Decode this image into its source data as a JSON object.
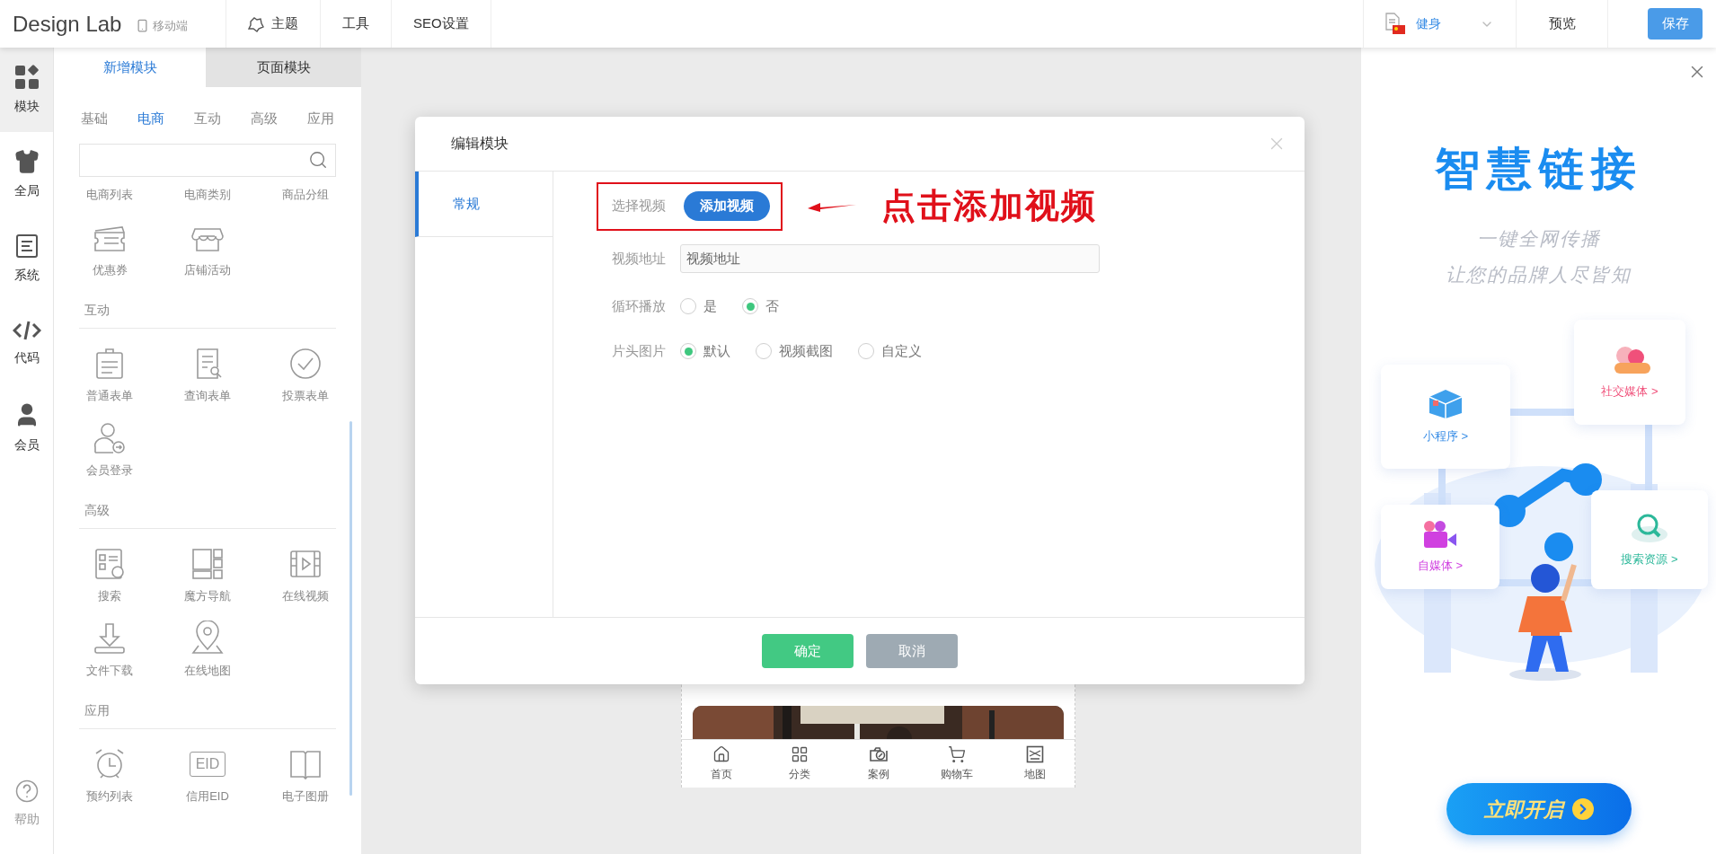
{
  "top_bar": {
    "logo": "Design Lab",
    "device": "移动端",
    "menu": [
      {
        "label": "主题",
        "kind": "icon"
      },
      {
        "label": "工具",
        "kind": "text"
      },
      {
        "label": "SEO设置",
        "kind": "text"
      }
    ],
    "language": "健身",
    "preview": "预览",
    "save": "保存"
  },
  "left_rail": {
    "items": [
      {
        "label": "模块",
        "selected": true
      },
      {
        "label": "全局",
        "selected": false
      },
      {
        "label": "系统",
        "selected": false
      },
      {
        "label": "代码",
        "selected": false
      },
      {
        "label": "会员",
        "selected": false
      }
    ],
    "help": "帮助"
  },
  "module_panel": {
    "tabs": [
      {
        "label": "新增模块",
        "selected": true
      },
      {
        "label": "页面模块",
        "selected": false
      }
    ],
    "categories": [
      {
        "label": "基础",
        "selected": false
      },
      {
        "label": "电商",
        "selected": true
      },
      {
        "label": "互动",
        "selected": false
      },
      {
        "label": "高级",
        "selected": false
      },
      {
        "label": "应用",
        "selected": false
      }
    ],
    "top_row_labels": [
      "电商列表",
      "电商类别",
      "商品分组"
    ],
    "sections": [
      {
        "items": [
          {
            "label": "优惠券"
          },
          {
            "label": "店铺活动"
          }
        ]
      },
      {
        "title": "互动",
        "items": [
          {
            "label": "普通表单"
          },
          {
            "label": "查询表单"
          },
          {
            "label": "投票表单"
          },
          {
            "label": "会员登录"
          }
        ]
      },
      {
        "title": "高级",
        "items": [
          {
            "label": "搜索"
          },
          {
            "label": "魔方导航"
          },
          {
            "label": "在线视频"
          },
          {
            "label": "文件下载"
          },
          {
            "label": "在线地图"
          }
        ]
      },
      {
        "title": "应用",
        "items": [
          {
            "label": "预约列表"
          },
          {
            "label": "信用EID",
            "icon_text": "EID"
          },
          {
            "label": "电子图册"
          }
        ]
      }
    ]
  },
  "dialog": {
    "title": "编辑模块",
    "tabs": [
      {
        "label": "常规",
        "selected": true
      }
    ],
    "fields": [
      {
        "kind": "button",
        "label": "选择视频",
        "button": "添加视频",
        "highlighted": true
      },
      {
        "kind": "input",
        "label": "视频地址",
        "value": "视频地址"
      },
      {
        "kind": "radio",
        "label": "循环播放",
        "options": [
          {
            "label": "是",
            "selected": false
          },
          {
            "label": "否",
            "selected": true
          }
        ]
      },
      {
        "kind": "radio",
        "label": "片头图片",
        "options": [
          {
            "label": "默认",
            "selected": true
          },
          {
            "label": "视频截图",
            "selected": false
          },
          {
            "label": "自定义",
            "selected": false
          }
        ]
      }
    ],
    "annotation": "点击添加视频",
    "buttons": [
      {
        "label": "确定",
        "kind": "primary"
      },
      {
        "label": "取消",
        "kind": "secondary"
      }
    ]
  },
  "phone": {
    "tabs": [
      {
        "label": "首页"
      },
      {
        "label": "分类"
      },
      {
        "label": "案例"
      },
      {
        "label": "购物车"
      },
      {
        "label": "地图"
      }
    ]
  },
  "ad": {
    "title": "智慧链接",
    "subtitle": [
      "一键全网传播",
      "让您的品牌人尽皆知"
    ],
    "cards": [
      {
        "label": "小程序 >",
        "color": "#3a8ee6"
      },
      {
        "label": "社交媒体 >",
        "color": "#f0507a"
      },
      {
        "label": "自媒体 >",
        "color": "#d040e0"
      },
      {
        "label": "搜索资源 >",
        "color": "#2cb89a"
      }
    ],
    "cta": "立即开启"
  }
}
